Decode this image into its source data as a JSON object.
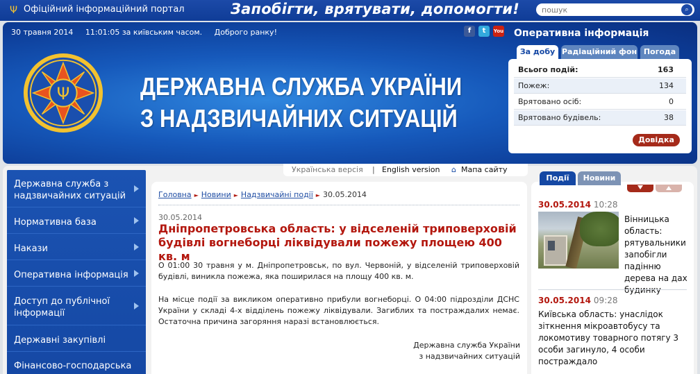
{
  "topbar": {
    "portal": "Офіційний інформаційний портал",
    "slogan": "Запобігти, врятувати, допомогти!",
    "search_placeholder": "пошук"
  },
  "header": {
    "date": "30 травня 2014",
    "time": "11:01:05 за київським часом.",
    "greeting": "Доброго ранку!",
    "title_line1": "ДЕРЖАВНА СЛУЖБА УКРАЇНИ",
    "title_line2": "З НАДЗВИЧАЙНИХ СИТУАЦІЙ",
    "social": [
      "f",
      "t",
      "You"
    ]
  },
  "operative": {
    "title": "Оперативна інформація",
    "tabs": [
      "За добу",
      "Радіаційний фон",
      "Погода"
    ],
    "rows": [
      {
        "label": "Всього подій:",
        "value": "163"
      },
      {
        "label": "Пожеж:",
        "value": "134"
      },
      {
        "label": "Врятовано осіб:",
        "value": "0"
      },
      {
        "label": "Врятовано будівель:",
        "value": "38"
      }
    ],
    "help_button": "Довідка"
  },
  "sidebar": {
    "items": [
      "Державна служба з надзвичайних ситуацій",
      "Нормативна база",
      "Накази",
      "Оперативна інформація",
      "Доступ до публічної інформації",
      "Державні закупівлі",
      "Фінансово-господарська"
    ]
  },
  "langbar": {
    "ukrainian": "Українська версія",
    "separator": "|",
    "english": "English version",
    "sitemap": "Мапа сайту"
  },
  "article": {
    "breadcrumbs": [
      "Головна",
      "Новини",
      "Надзвичайні події",
      "30.05.2014"
    ],
    "date": "30.05.2014",
    "title": "Дніпропетровська область: у відселеній триповерховій будівлі вогнеборці ліквідували пожежу площею 400 кв. м",
    "paragraph1": "О 01:00 30 травня у м. Дніпропетровськ, по вул. Червоній, у відселеній триповерховій будівлі, виникла пожежа, яка поширилася на площу 400 кв. м.",
    "paragraph2": "На місце події за викликом оперативно прибули вогнеборці. О 04:00 підрозділи ДСНС України у складі 4-х відділень пожежу ліквідували. Загиблих та постраждалих немає. Остаточна причина загоряння наразі встановлюється.",
    "signature_line1": "Державна служба України",
    "signature_line2": "з надзвичайних ситуацій"
  },
  "news": {
    "tabs": [
      "Події",
      "Новини"
    ],
    "items": [
      {
        "date": "30.05.2014",
        "time": "10:28",
        "text": "Вінницька область: рятувальники запобігли падінню дерева на дах будинку"
      },
      {
        "date": "30.05.2014",
        "time": "09:28",
        "text": "Київська область: унаслідок зіткнення мікроавтобусу та локомотиву товарного потягу 3 особи загинуло, 4 особи постраждало"
      }
    ]
  },
  "colors": {
    "brand_blue": "#1548a4",
    "accent_red": "#b3170e",
    "help_red": "#a52a1a"
  }
}
